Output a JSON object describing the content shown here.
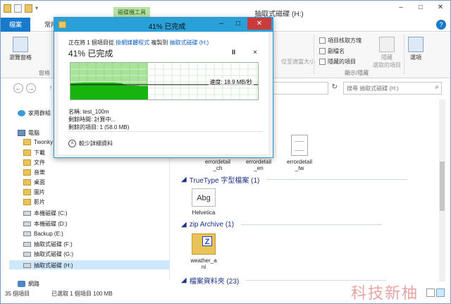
{
  "explorer": {
    "title": "抽取式磁碟 (H:)",
    "context_tab": "磁碟機工具",
    "window_controls": {
      "minimize": "–",
      "maximize": "□",
      "close": "✕"
    },
    "help": "?"
  },
  "ribbon_tabs": {
    "file": "檔案",
    "home": "常用"
  },
  "ribbon": {
    "nav_pane_label": "瀏覽窗格",
    "pane_group": "窗格",
    "size_columns_label": "位至適當大小",
    "checkboxes": [
      "項目核取方塊",
      "副檔名",
      "隱藏的項目"
    ],
    "hide_selected_label": "隱藏\n選取的項目",
    "show_hide_group": "顯示/隱藏",
    "options_label": "選項"
  },
  "address": {
    "back": "←",
    "forward": "→",
    "up": "↑",
    "refresh": "↻",
    "search_placeholder": "搜尋 抽取式磁碟 (H:)",
    "search_icon": "search-icon"
  },
  "nav": {
    "homegroup": "家用群組",
    "computer": "電腦",
    "items": [
      "Twonky",
      "下載",
      "文件",
      "音樂",
      "桌面",
      "圖片",
      "影片",
      "本機磁碟 (C:)",
      "本機磁碟 (D:)",
      "Backup (E:)",
      "抽取式磁碟 (F:)",
      "抽取式磁碟 (G:)",
      "抽取式磁碟 (H:)"
    ],
    "network": "網路"
  },
  "content": {
    "top_files": [
      {
        "name": "errordetail_ch",
        "label1": "errordetail",
        "label2": "_ch"
      },
      {
        "name": "errordetail_en",
        "label1": "errordetail",
        "label2": "_en"
      },
      {
        "name": "errordetail_tw",
        "label1": "errordetail",
        "label2": "_tw"
      }
    ],
    "groups": [
      {
        "header": "TrueType 字型檔案 (1)",
        "file": "Helvetica",
        "icon_text": "Abg"
      },
      {
        "header": "zip Archive (1)",
        "file1": "weather_a",
        "file2": "ni",
        "icon_text": "Z"
      },
      {
        "header": "檔案資料夾 (23)"
      }
    ]
  },
  "status": {
    "count": "35 個項目",
    "selected": "已選取 1 個項目 100 MB"
  },
  "dialog": {
    "title": "41% 已完成",
    "line_prefix": "正在將 1 個項目從",
    "source": "掛網媒體程式",
    "line_mid": "複製到",
    "dest": "抽取式磁碟 (H:)",
    "percent_text": "41% 已完成",
    "pause": "II",
    "cancel": "×",
    "speed": "速度: 18.9 MB/秒",
    "name_line": "名稱: test_100m",
    "time_line": "剩餘時間: 計算中...",
    "items_line": "剩餘的項目: 1 (58.0 MB)",
    "details": "較少詳細資料",
    "details_icon": "chevron-up-icon",
    "progress": 0.41
  },
  "watermark": "科技新柚"
}
